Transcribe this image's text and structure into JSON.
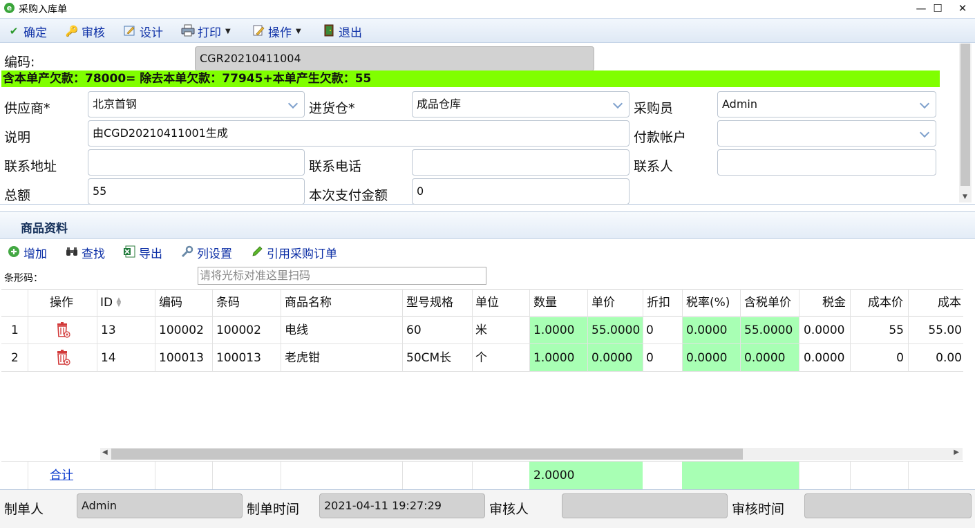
{
  "window": {
    "title": "采购入库单",
    "minimize": "—",
    "maximize": "☐",
    "close": "✕"
  },
  "toolbar": {
    "confirm": "确定",
    "audit": "审核",
    "design": "设计",
    "print": "打印",
    "operate": "操作",
    "exit": "退出"
  },
  "form": {
    "code_label": "编码:",
    "code_value": "CGR20210411004",
    "debt_text": "含本单产欠款：78000= 除去本单欠款：77945+本单产生欠款：55",
    "supplier_label": "供应商*",
    "supplier_value": "北京首钢",
    "warehouse_label": "进货仓*",
    "warehouse_value": "成品仓库",
    "buyer_label": "采购员",
    "buyer_value": "Admin",
    "note_label": "说明",
    "note_value": "由CGD20210411001生成",
    "account_label": "付款帐户",
    "account_value": "",
    "address_label": "联系地址",
    "address_value": "",
    "phone_label": "联系电话",
    "phone_value": "",
    "contact_label": "联系人",
    "contact_value": "",
    "total_label": "总额",
    "total_value": "55",
    "pay_label": "本次支付金额",
    "pay_value": "0"
  },
  "goods": {
    "title": "商品资料",
    "add": "增加",
    "find": "查找",
    "export": "导出",
    "columns": "列设置",
    "ref_order": "引用采购订单",
    "barcode_label": "条形码：",
    "barcode_placeholder": "请将光标对准这里扫码",
    "headers": [
      "操作",
      "ID",
      "编码",
      "条码",
      "商品名称",
      "型号规格",
      "单位",
      "数量",
      "单价",
      "折扣",
      "税率(%)",
      "含税单价",
      "税金",
      "成本价",
      "成本"
    ],
    "rows": [
      {
        "no": "1",
        "id": "13",
        "code": "100002",
        "barcode": "100002",
        "name": "电线",
        "spec": "60",
        "unit": "米",
        "qty": "1.0000",
        "price": "55.0000",
        "discount": "0",
        "tax_rate": "0.0000",
        "tax_price": "55.0000",
        "tax": "0.0000",
        "cost_price": "55",
        "cost": "55.00"
      },
      {
        "no": "2",
        "id": "14",
        "code": "100013",
        "barcode": "100013",
        "name": "老虎钳",
        "spec": "50CM长",
        "unit": "个",
        "qty": "1.0000",
        "price": "0.0000",
        "discount": "0",
        "tax_rate": "0.0000",
        "tax_price": "0.0000",
        "tax": "0.0000",
        "cost_price": "0",
        "cost": "0.00"
      }
    ],
    "sum_label": "合计",
    "sum_qty": "2.0000"
  },
  "footer": {
    "maker_label": "制单人",
    "maker_value": "Admin",
    "make_time_label": "制单时间",
    "make_time_value": "2021-04-11 19:27:29",
    "auditor_label": "审核人",
    "auditor_value": "",
    "audit_time_label": "审核时间",
    "audit_time_value": ""
  },
  "colors": {
    "debt_bar": "#80ff00",
    "editable_cell": "#a8ffb4",
    "toolbar_text": "#0c2fa6"
  }
}
